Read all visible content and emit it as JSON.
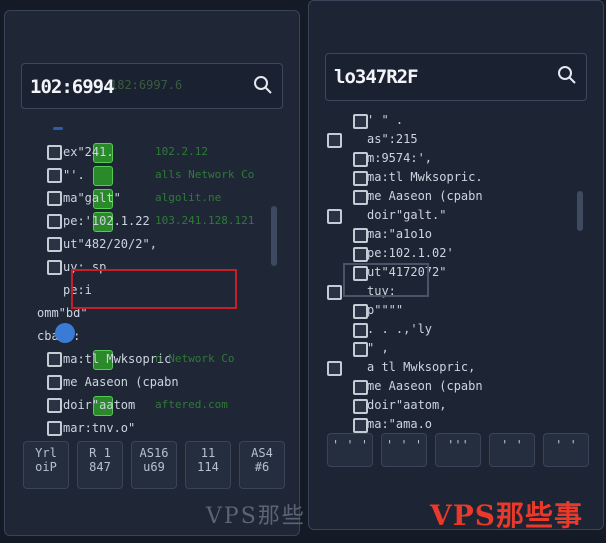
{
  "left_panel": {
    "search": {
      "value": "102:6994",
      "ghost": "182:6997.6"
    },
    "rows": [
      {
        "text": "ex\"241.",
        "ip": "102.2.12",
        "badge": true
      },
      {
        "text": "   \"'.",
        "ip": "alls Network Co",
        "badge": true
      },
      {
        "text": "ma\"galt\"",
        "ip": "algolit.ne",
        "badge": true
      },
      {
        "text": "pe:'102.1.22",
        "ip": "103.241.128.121",
        "badge": true
      },
      {
        "text": "ut\"482/20/2\",",
        "ip": "",
        "badge": false
      },
      {
        "text": "uy: sp",
        "ip": "",
        "badge": false
      },
      {
        "text": "pe:i",
        "ip": "",
        "badge": false
      },
      {
        "text": "omm\"bd\"",
        "ip": "",
        "badge": false
      },
      {
        "text": "cbane:",
        "ip": "",
        "badge": false
      },
      {
        "text": "ma:tl Mwksopric",
        "ip": "n Network Co",
        "badge": true
      },
      {
        "text": "me Aaseon (cpabn",
        "ip": "",
        "badge": false
      },
      {
        "text": "doir\"aatom",
        "ip": "aftered.com",
        "badge": true
      },
      {
        "text": "mar:tnv.o\"",
        "ip": "",
        "badge": false
      }
    ],
    "buttons": [
      {
        "top": "Yrl",
        "bottom": "oiP"
      },
      {
        "top": "R 1",
        "bottom": "847"
      },
      {
        "top": "AS16",
        "bottom": "u69"
      },
      {
        "top": "11",
        "bottom": "114"
      },
      {
        "top": "AS4",
        "bottom": "#6"
      }
    ]
  },
  "right_panel": {
    "search": {
      "value": "lo347R2F"
    },
    "rows": [
      {
        "text": "  '  \"   ."
      },
      {
        "text": "as\":215"
      },
      {
        "text": "m:9574:',"
      },
      {
        "text": "ma:tl Mwksopric."
      },
      {
        "text": "me Aaseon (cpabn"
      },
      {
        "text": "doir\"galt.\""
      },
      {
        "text": "ma:\"a1o1o"
      },
      {
        "text": "pe:102.1.02'"
      },
      {
        "text": "ut\"4172072\""
      },
      {
        "text": "tuy:"
      },
      {
        "text": "p\"\"\"\""
      },
      {
        "text": ". . .,'ly"
      },
      {
        "text": "   \"    ,"
      },
      {
        "text": "a  tl Mwksopric,"
      },
      {
        "text": "me Aaseon (cpabn"
      },
      {
        "text": "doir\"aatom,"
      },
      {
        "text": "ma:\"ama.o"
      }
    ],
    "buttons": [
      {
        "top": "' '  '"
      },
      {
        "top": "' '  '"
      },
      {
        "top": "'''"
      },
      {
        "top": "' '"
      },
      {
        "top": "' '"
      }
    ]
  },
  "watermark": {
    "ghost": "VPS那些",
    "text": "VPS那些事"
  },
  "colors": {
    "highlight": "#c61f28",
    "badge": "#2a8a2a",
    "accent": "#3a7bd5"
  }
}
